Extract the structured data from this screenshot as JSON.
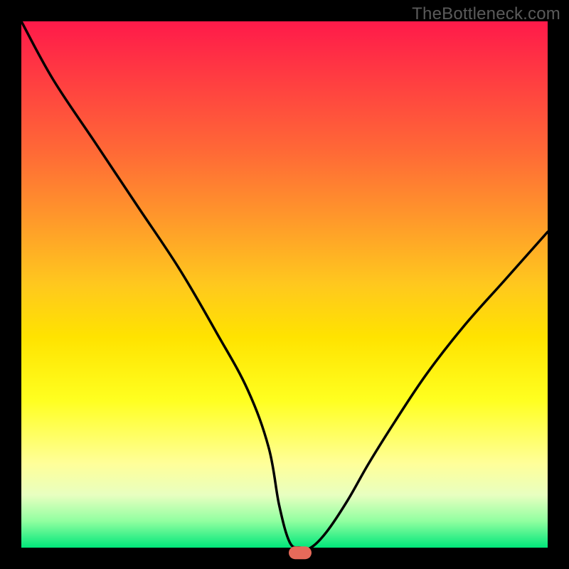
{
  "watermark": "TheBottleneck.com",
  "chart_data": {
    "type": "line",
    "title": "",
    "xlabel": "",
    "ylabel": "",
    "xlim": [
      0,
      100
    ],
    "ylim": [
      0,
      100
    ],
    "grid": false,
    "legend": false,
    "background_gradient": [
      "#ff1a4a",
      "#ff6a36",
      "#ffc81e",
      "#ffff20",
      "#ffff99",
      "#00e67a"
    ],
    "marker": {
      "x": 53,
      "y": 0,
      "shape": "pill",
      "color": "#e66a5a"
    },
    "series": [
      {
        "name": "bottleneck-curve",
        "x": [
          0,
          6,
          14,
          22,
          30,
          37,
          43,
          47,
          49,
          51,
          53,
          55,
          58,
          62,
          66,
          71,
          77,
          84,
          92,
          100
        ],
        "values": [
          100,
          89,
          77,
          65,
          53,
          41,
          30,
          19,
          8,
          1,
          0,
          0,
          3,
          9,
          16,
          24,
          33,
          42,
          51,
          60
        ]
      }
    ],
    "annotations": []
  }
}
